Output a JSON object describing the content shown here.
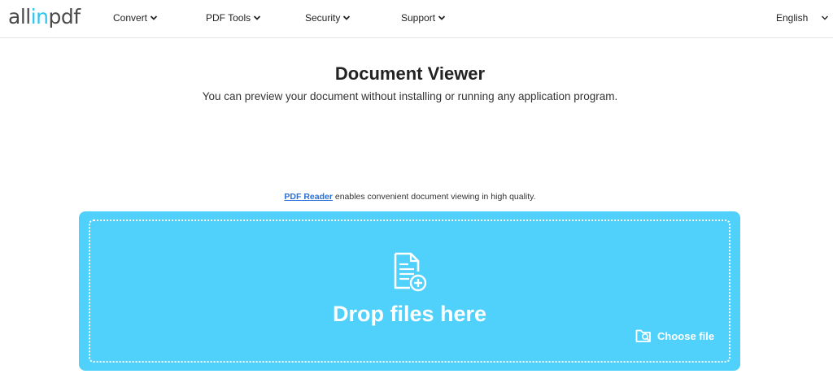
{
  "logo": {
    "part1": "all",
    "part2": "in",
    "part3": "pdf"
  },
  "nav": {
    "items": [
      {
        "label": "Convert",
        "icon": "chevron-down-icon"
      },
      {
        "label": "PDF Tools",
        "icon": "chevron-down-icon"
      },
      {
        "label": "Security",
        "icon": "chevron-down-icon"
      },
      {
        "label": "Support",
        "icon": "chevron-down-icon"
      }
    ],
    "language": "English"
  },
  "main": {
    "title": "Document Viewer",
    "subtitle": "You can preview your document without installing or running any application program.",
    "note_link": "PDF Reader",
    "note_text": " enables convenient document viewing in high quality."
  },
  "dropzone": {
    "label": "Drop files here",
    "choose_file": "Choose file",
    "icon": "file-add-icon",
    "choose_icon": "folder-search-icon"
  },
  "colors": {
    "accent": "#4fd1fb",
    "logo_accent": "#2ec4f0",
    "link": "#2a6fd6"
  }
}
